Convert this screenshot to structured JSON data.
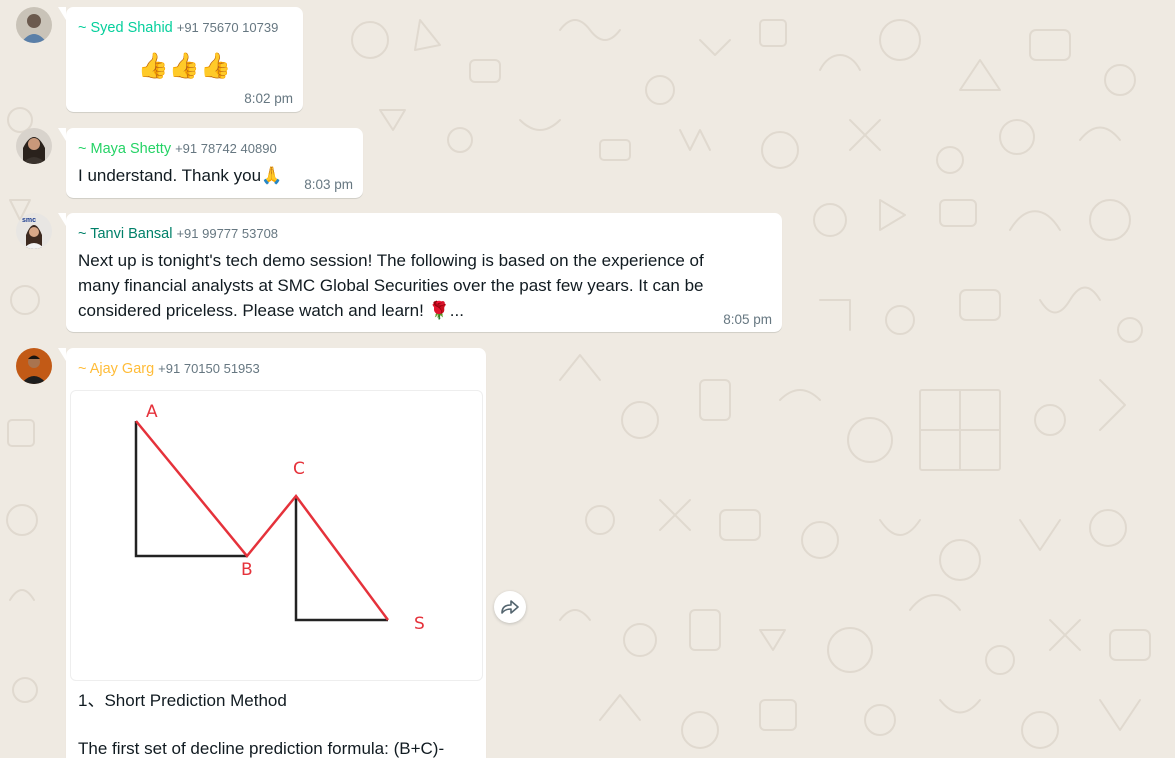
{
  "colors": {
    "chat_background": "#efeae2",
    "bubble_background": "#ffffff",
    "text_primary": "#111b21",
    "text_meta": "#667781",
    "sender_syed": "#06cf9c",
    "sender_maya": "#25d366",
    "sender_tanvi": "#008069",
    "sender_ajay": "#ffbc38",
    "chart_line": "#e5323b",
    "chart_axis": "#222222"
  },
  "messages": [
    {
      "sender_name": "~ Syed Shahid",
      "sender_phone": "+91 75670 10739",
      "text": "👍👍👍",
      "time": "8:02 pm"
    },
    {
      "sender_name": "~ Maya Shetty",
      "sender_phone": "+91 78742 40890",
      "text": "I understand. Thank you🙏",
      "time": "8:03 pm"
    },
    {
      "sender_name": "~ Tanvi Bansal",
      "sender_phone": "+91 99777 53708",
      "text_lines": [
        "Next up is tonight's tech demo session! The following is based on the experience of",
        "many financial analysts at SMC Global Securities over the past few years. It can be",
        "considered priceless. Please watch and learn! 🌹..."
      ],
      "time": "8:05 pm",
      "avatar_text": "smc"
    },
    {
      "sender_name": "~ Ajay Garg",
      "sender_phone": "+91 70150 51953",
      "image": {
        "point_labels": [
          "A",
          "B",
          "C",
          "S"
        ]
      },
      "caption_title": "1、Short Prediction Method",
      "caption_body": "The first set of decline prediction formula: (B+C)-"
    }
  ],
  "forward_button": {
    "icon": "forward-icon"
  }
}
